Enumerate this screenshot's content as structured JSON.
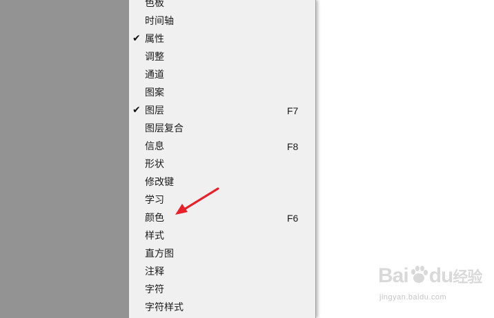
{
  "menu": {
    "items": [
      {
        "label": "色板",
        "checked": false,
        "shortcut": ""
      },
      {
        "label": "时间轴",
        "checked": false,
        "shortcut": ""
      },
      {
        "label": "属性",
        "checked": true,
        "shortcut": ""
      },
      {
        "label": "调整",
        "checked": false,
        "shortcut": ""
      },
      {
        "label": "通道",
        "checked": false,
        "shortcut": ""
      },
      {
        "label": "图案",
        "checked": false,
        "shortcut": ""
      },
      {
        "label": "图层",
        "checked": true,
        "shortcut": "F7"
      },
      {
        "label": "图层复合",
        "checked": false,
        "shortcut": ""
      },
      {
        "label": "信息",
        "checked": false,
        "shortcut": "F8"
      },
      {
        "label": "形状",
        "checked": false,
        "shortcut": ""
      },
      {
        "label": "修改键",
        "checked": false,
        "shortcut": ""
      },
      {
        "label": "学习",
        "checked": false,
        "shortcut": ""
      },
      {
        "label": "颜色",
        "checked": false,
        "shortcut": "F6"
      },
      {
        "label": "样式",
        "checked": false,
        "shortcut": ""
      },
      {
        "label": "直方图",
        "checked": false,
        "shortcut": ""
      },
      {
        "label": "注释",
        "checked": false,
        "shortcut": ""
      },
      {
        "label": "字符",
        "checked": false,
        "shortcut": ""
      },
      {
        "label": "字符样式",
        "checked": false,
        "shortcut": ""
      }
    ],
    "check_glyph": "✔"
  },
  "annotation": {
    "arrow_color": "#e8202a",
    "target": "颜色"
  },
  "watermark": {
    "logo_text_a": "Bai",
    "logo_text_b": "du",
    "logo_cn": "经验",
    "url": "jingyan.baidu.com"
  },
  "colors": {
    "left_background": "#939393",
    "menu_background": "#f0f0f0",
    "page_background": "#ffffff"
  }
}
